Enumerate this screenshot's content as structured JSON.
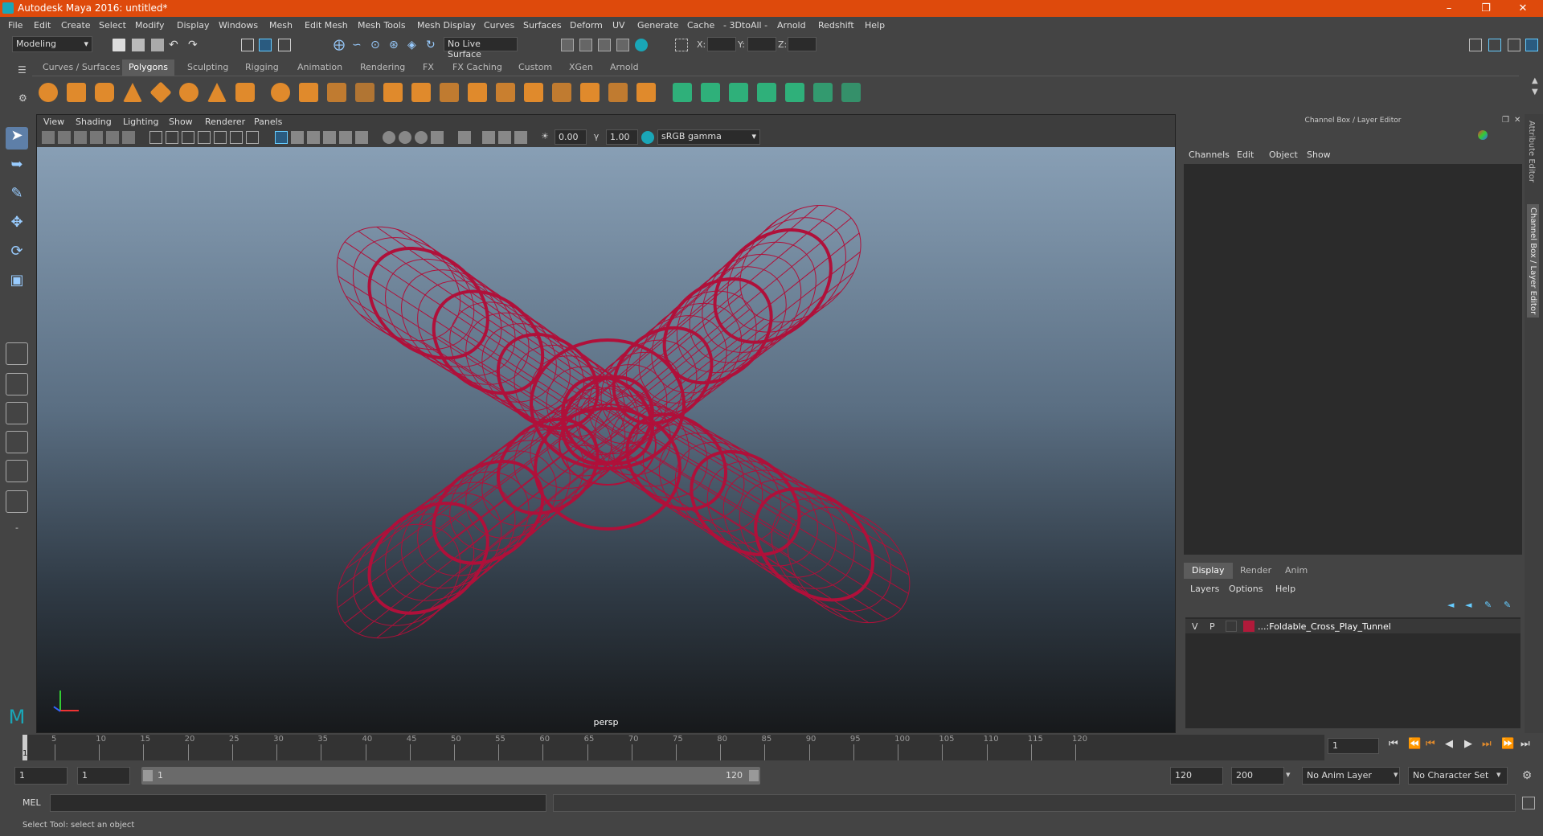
{
  "window": {
    "title": "Autodesk Maya 2016: untitled*"
  },
  "menubar": [
    "File",
    "Edit",
    "Create",
    "Select",
    "Modify",
    "Display",
    "Windows",
    "Mesh",
    "Edit Mesh",
    "Mesh Tools",
    "Mesh Display",
    "Curves",
    "Surfaces",
    "Deform",
    "UV",
    "Generate",
    "Cache",
    "- 3DtoAll -",
    "Arnold",
    "Redshift",
    "Help"
  ],
  "statusline": {
    "menuset": "Modeling",
    "live_surface": "No Live Surface",
    "x_label": "X:",
    "y_label": "Y:",
    "z_label": "Z:"
  },
  "shelf_tabs": [
    "Curves / Surfaces",
    "Polygons",
    "Sculpting",
    "Rigging",
    "Animation",
    "Rendering",
    "FX",
    "FX Caching",
    "Custom",
    "XGen",
    "Arnold"
  ],
  "shelf_active": "Polygons",
  "viewport": {
    "menus": [
      "View",
      "Shading",
      "Lighting",
      "Show",
      "Renderer",
      "Panels"
    ],
    "exposure": "0.00",
    "gamma": "1.00",
    "color_space": "sRGB gamma",
    "camera": "persp"
  },
  "channel_box": {
    "title": "Channel Box / Layer Editor",
    "menus": [
      "Channels",
      "Edit",
      "Object",
      "Show"
    ]
  },
  "layer_editor": {
    "tabs": [
      "Display",
      "Render",
      "Anim"
    ],
    "active_tab": "Display",
    "menus": [
      "Layers",
      "Options",
      "Help"
    ],
    "layers": [
      {
        "v": "V",
        "p": "P",
        "color": "#b01a3a",
        "name": "...:Foldable_Cross_Play_Tunnel"
      }
    ]
  },
  "side_tabs": [
    "Attribute Editor",
    "Channel Box / Layer Editor"
  ],
  "timeline": {
    "ticks": [
      "5",
      "10",
      "15",
      "20",
      "25",
      "30",
      "35",
      "40",
      "45",
      "50",
      "55",
      "60",
      "65",
      "70",
      "75",
      "80",
      "85",
      "90",
      "95",
      "100",
      "105",
      "110",
      "115",
      "120"
    ],
    "current_frame_marker": "1",
    "current_frame": "1"
  },
  "range": {
    "start": "1",
    "playback_start": "1",
    "slider_start": "1",
    "slider_end": "120",
    "playback_end": "120",
    "end": "200",
    "anim_layer": "No Anim Layer",
    "character_set": "No Character Set"
  },
  "command_line": {
    "label": "MEL"
  },
  "help_line": "Select Tool: select an object",
  "wireframe_color": "#b0103a"
}
